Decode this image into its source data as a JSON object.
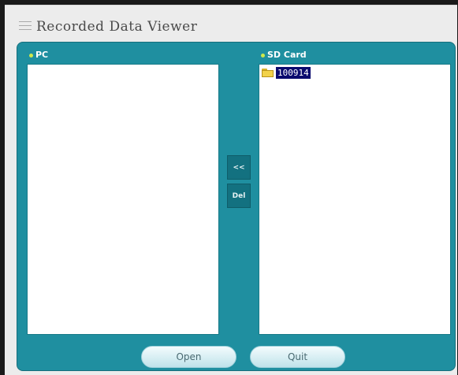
{
  "window": {
    "title": "Recorded Data Viewer"
  },
  "pc": {
    "label": "PC",
    "items": []
  },
  "sd_card": {
    "label": "SD Card",
    "items": [
      {
        "name": "100914",
        "type": "folder",
        "selected": true
      }
    ]
  },
  "transfer": {
    "copy_label": "<<",
    "delete_label": "Del"
  },
  "footer": {
    "open_label": "Open",
    "quit_label": "Quit"
  },
  "colors": {
    "panel": "#1f8fa0",
    "window_bg": "#ececec",
    "selection": "#0a0a6e",
    "label_dot": "#cfe94a"
  }
}
